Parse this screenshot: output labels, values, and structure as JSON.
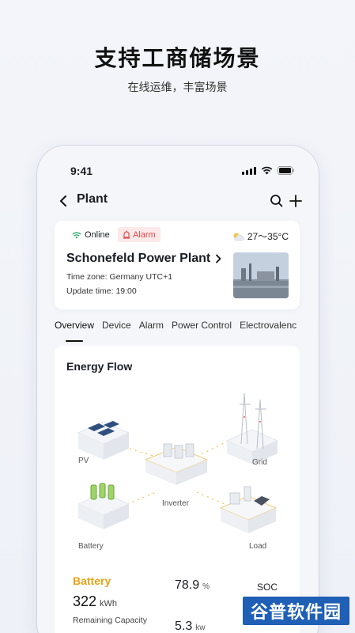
{
  "promo": {
    "title": "支持工商储场景",
    "subtitle": "在线运维，丰富场景"
  },
  "status_bar": {
    "time": "9:41"
  },
  "nav": {
    "title": "Plant",
    "icons": [
      "back-icon",
      "search-icon",
      "plus-icon"
    ]
  },
  "plant": {
    "status": "Online",
    "alarm": "Alarm",
    "weather": "27～35°C",
    "name": "Schonefeld Power Plant",
    "timezone": "Time zone:  Germany  UTC+1",
    "update_time": "Update time:  19:00"
  },
  "tabs": [
    "Overview",
    "Device",
    "Alarm",
    "Power Control",
    "Electrovalenc"
  ],
  "energy_flow": {
    "title": "Energy Flow",
    "labels": {
      "pv": "PV",
      "grid": "Grid",
      "inverter": "Inverter",
      "battery": "Battery",
      "load": "Load"
    }
  },
  "stats": {
    "battery_title": "Battery",
    "capacity_value": "322",
    "capacity_unit": "kWh",
    "capacity_label": "Remaining Capacity",
    "soc_value": "78.9",
    "soc_unit": "%",
    "soc_label": "SOC",
    "power_value": "5.3",
    "power_unit": "kw"
  },
  "watermark": "谷普软件园",
  "colors": {
    "accent": "#e8a317",
    "online": "#18a058",
    "alarm": "#e14b4b",
    "watermark_bg": "#1f5fb6"
  }
}
